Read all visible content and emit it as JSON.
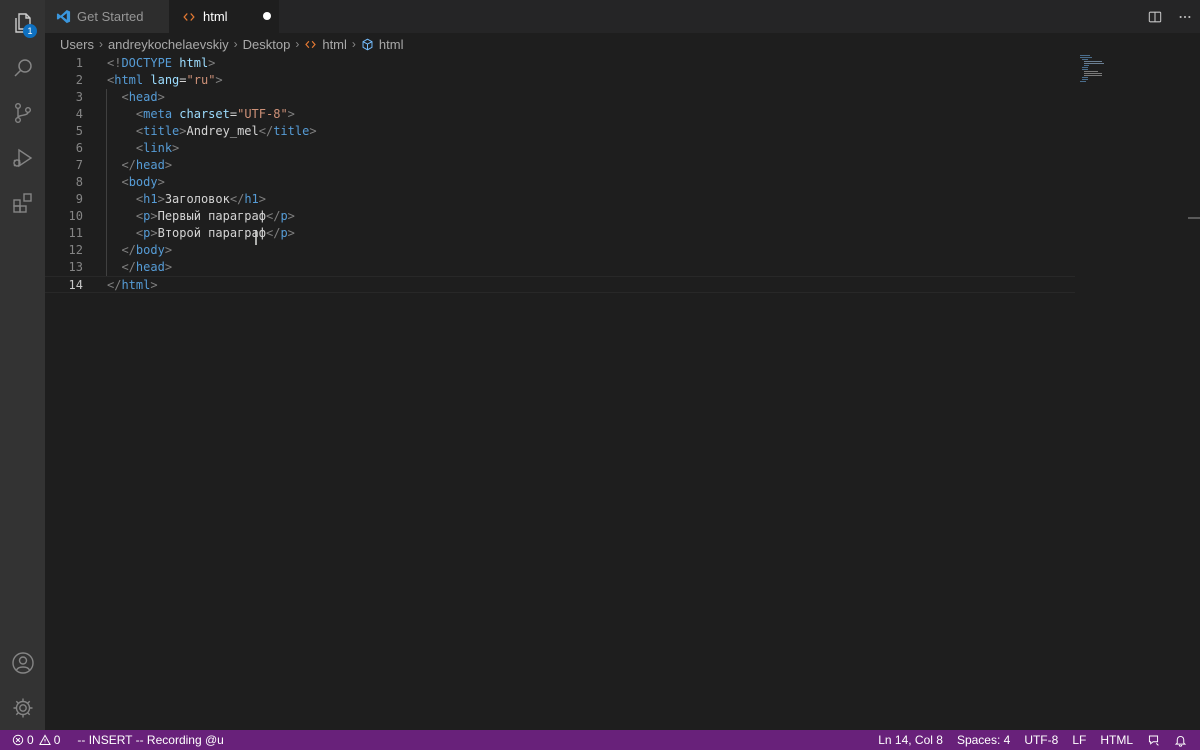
{
  "activity_bar": {
    "explorer_badge": "1",
    "icons": [
      "files-icon",
      "search-icon",
      "source-control-icon",
      "run-debug-icon",
      "extensions-icon",
      "account-icon",
      "settings-gear-icon"
    ]
  },
  "tabs": [
    {
      "label": "Get Started",
      "icon": "vscode-logo-icon",
      "active": false
    },
    {
      "label": "html",
      "icon": "html-file-icon",
      "active": true,
      "dirty": true
    }
  ],
  "tab_actions": [
    "split-editor-icon",
    "more-actions-icon"
  ],
  "breadcrumb": [
    "Users",
    "andreykochelaevskiy",
    "Desktop",
    "html",
    "html"
  ],
  "editor": {
    "current_line": 14,
    "lines": [
      {
        "n": "1",
        "segs": [
          [
            "t",
            "<!"
          ],
          [
            "tag",
            "DOCTYPE"
          ],
          [
            "txt",
            " "
          ],
          [
            "attr",
            "html"
          ],
          [
            "t",
            ">"
          ]
        ]
      },
      {
        "n": "2",
        "segs": [
          [
            "t",
            "<"
          ],
          [
            "tag",
            "html"
          ],
          [
            "txt",
            " "
          ],
          [
            "attr",
            "lang"
          ],
          [
            "txt",
            "="
          ],
          [
            "str",
            "\"ru\""
          ],
          [
            "t",
            ">"
          ]
        ]
      },
      {
        "n": "3",
        "segs": [
          [
            "txt",
            "  "
          ],
          [
            "t",
            "<"
          ],
          [
            "tag",
            "head"
          ],
          [
            "t",
            ">"
          ]
        ]
      },
      {
        "n": "4",
        "segs": [
          [
            "txt",
            "    "
          ],
          [
            "t",
            "<"
          ],
          [
            "tag",
            "meta"
          ],
          [
            "txt",
            " "
          ],
          [
            "attr",
            "charset"
          ],
          [
            "txt",
            "="
          ],
          [
            "str",
            "\"UTF-8\""
          ],
          [
            "t",
            ">"
          ]
        ]
      },
      {
        "n": "5",
        "segs": [
          [
            "txt",
            "    "
          ],
          [
            "t",
            "<"
          ],
          [
            "tag",
            "title"
          ],
          [
            "t",
            ">"
          ],
          [
            "txt",
            "Andrey_mel"
          ],
          [
            "t",
            "</"
          ],
          [
            "tag",
            "title"
          ],
          [
            "t",
            ">"
          ]
        ]
      },
      {
        "n": "6",
        "segs": [
          [
            "txt",
            "    "
          ],
          [
            "t",
            "<"
          ],
          [
            "tag",
            "link"
          ],
          [
            "t",
            ">"
          ]
        ]
      },
      {
        "n": "7",
        "segs": [
          [
            "txt",
            "  "
          ],
          [
            "t",
            "</"
          ],
          [
            "tag",
            "head"
          ],
          [
            "t",
            ">"
          ]
        ]
      },
      {
        "n": "8",
        "segs": [
          [
            "txt",
            "  "
          ],
          [
            "t",
            "<"
          ],
          [
            "tag",
            "body"
          ],
          [
            "t",
            ">"
          ]
        ]
      },
      {
        "n": "9",
        "segs": [
          [
            "txt",
            "    "
          ],
          [
            "t",
            "<"
          ],
          [
            "tag",
            "h1"
          ],
          [
            "t",
            ">"
          ],
          [
            "txt",
            "Заголовок"
          ],
          [
            "t",
            "</"
          ],
          [
            "tag",
            "h1"
          ],
          [
            "t",
            ">"
          ]
        ]
      },
      {
        "n": "10",
        "segs": [
          [
            "txt",
            "    "
          ],
          [
            "t",
            "<"
          ],
          [
            "tag",
            "p"
          ],
          [
            "t",
            ">"
          ],
          [
            "txt",
            "Первый параграф"
          ],
          [
            "t",
            "</"
          ],
          [
            "tag",
            "p"
          ],
          [
            "t",
            ">"
          ]
        ]
      },
      {
        "n": "11",
        "segs": [
          [
            "txt",
            "    "
          ],
          [
            "t",
            "<"
          ],
          [
            "tag",
            "p"
          ],
          [
            "t",
            ">"
          ],
          [
            "txt",
            "Второй параграф"
          ],
          [
            "t",
            "</"
          ],
          [
            "tag",
            "p"
          ],
          [
            "t",
            ">"
          ]
        ]
      },
      {
        "n": "12",
        "segs": [
          [
            "txt",
            "  "
          ],
          [
            "t",
            "</"
          ],
          [
            "tag",
            "body"
          ],
          [
            "t",
            ">"
          ]
        ]
      },
      {
        "n": "13",
        "segs": [
          [
            "txt",
            "  "
          ],
          [
            "t",
            "</"
          ],
          [
            "tag",
            "head"
          ],
          [
            "t",
            ">"
          ]
        ]
      },
      {
        "n": "14",
        "segs": [
          [
            "t",
            "</"
          ],
          [
            "tag",
            "html"
          ],
          [
            "t",
            ">"
          ]
        ]
      }
    ]
  },
  "status_bar": {
    "errors": "0",
    "warnings": "0",
    "vim_mode": "-- INSERT -- Recording @u",
    "position": "Ln 14, Col 8",
    "indentation": "Spaces: 4",
    "encoding": "UTF-8",
    "eol": "LF",
    "language": "HTML"
  },
  "colors": {
    "status_bar": "#68217a",
    "tag": "#569cd6",
    "attribute": "#9cdcfe",
    "string": "#ce9178",
    "punctuation": "#808080"
  }
}
